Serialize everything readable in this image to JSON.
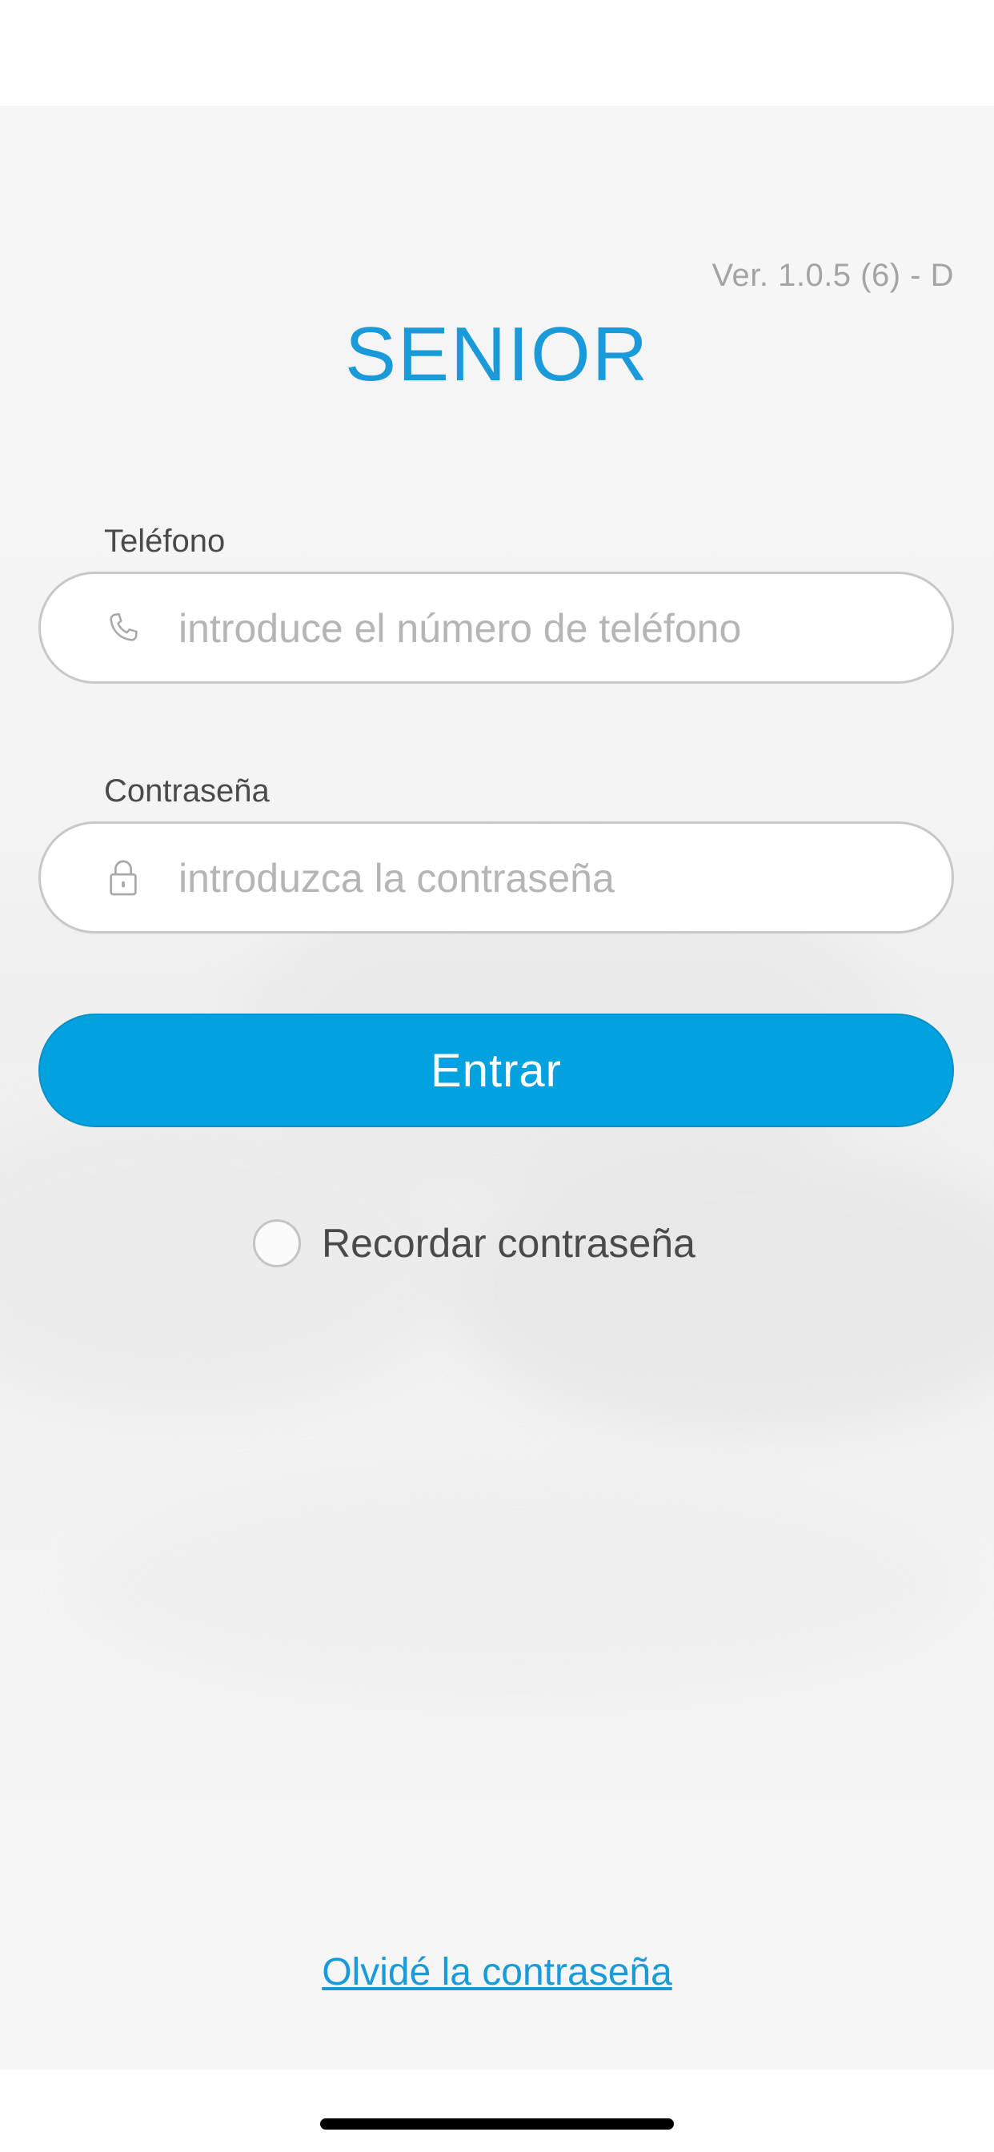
{
  "app": {
    "title": "SENIOR",
    "version": "Ver. 1.0.5 (6) - D"
  },
  "form": {
    "phone": {
      "label": "Teléfono",
      "placeholder": "introduce el número de teléfono",
      "icon": "phone-icon"
    },
    "password": {
      "label": "Contraseña",
      "placeholder": "introduzca la contraseña",
      "icon": "lock-icon"
    },
    "submit_label": "Entrar",
    "remember": {
      "label": "Recordar contraseña",
      "checked": false
    },
    "forgot_label": "Olvidé la contraseña"
  },
  "colors": {
    "accent": "#02a1df",
    "title": "#1a9ad9",
    "placeholder": "#b5b5b5",
    "border": "#c8c8c8"
  }
}
